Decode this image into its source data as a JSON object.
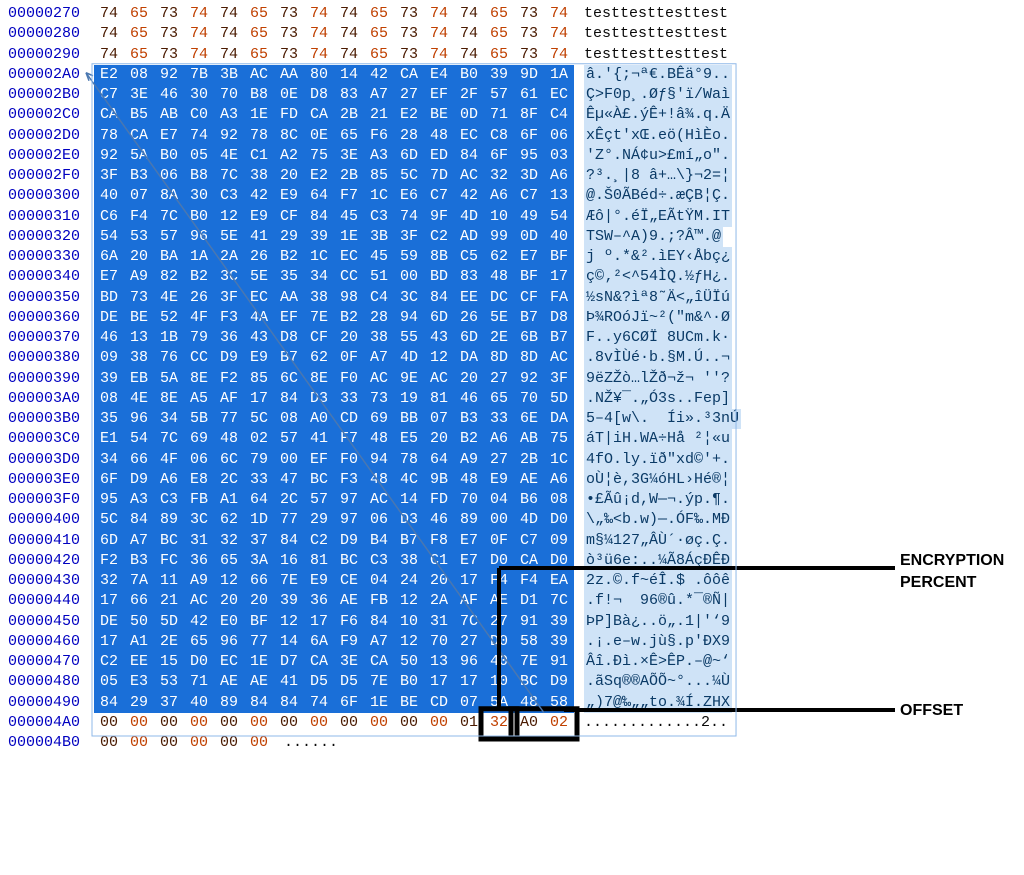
{
  "rows": [
    {
      "off": "00000270",
      "hex": "74 65 73 74 74 65 73 74 74 65 73 74 74 65 73 74",
      "asc": "testtesttesttest",
      "sel": false
    },
    {
      "off": "00000280",
      "hex": "74 65 73 74 74 65 73 74 74 65 73 74 74 65 73 74",
      "asc": "testtesttesttest",
      "sel": false
    },
    {
      "off": "00000290",
      "hex": "74 65 73 74 74 65 73 74 74 65 73 74 74 65 73 74",
      "asc": "testtesttesttest",
      "sel": false
    },
    {
      "off": "000002A0",
      "hex": "E2 08 92 7B 3B AC AA 80 14 42 CA E4 B0 39 9D 1A",
      "asc": "â.'{;¬ª€.BÊä°9..",
      "sel": true
    },
    {
      "off": "000002B0",
      "hex": "C7 3E 46 30 70 B8 0E D8 83 A7 27 EF 2F 57 61 EC",
      "asc": "Ç>F0p¸.Øƒ§'ï/Waì",
      "sel": true
    },
    {
      "off": "000002C0",
      "hex": "CA B5 AB C0 A3 1E FD CA 2B 21 E2 BE 0D 71 8F C4",
      "asc": "Êµ«À£.ýÊ+!â¾.q.Ä",
      "sel": true
    },
    {
      "off": "000002D0",
      "hex": "78 CA E7 74 92 78 8C 0E 65 F6 28 48 EC C8 6F 06",
      "asc": "xÊçt'xŒ.eö(HìÈo.",
      "sel": true
    },
    {
      "off": "000002E0",
      "hex": "92 5A B0 05 4E C1 A2 75 3E A3 6D ED 84 6F 95 03",
      "asc": "'Z°.NÁ¢u>£mí„o\".",
      "sel": true
    },
    {
      "off": "000002F0",
      "hex": "3F B3 06 B8 7C 38 20 E2 2B 85 5C 7D AC 32 3D A6",
      "asc": "?³.¸|8 â+…\\}¬2=¦",
      "sel": true
    },
    {
      "off": "00000300",
      "hex": "40 07 8A 30 C3 42 E9 64 F7 1C E6 C7 42 A6 C7 13",
      "asc": "@.Š0ÃBéd÷.æÇB¦Ç.",
      "sel": true
    },
    {
      "off": "00000310",
      "hex": "C6 F4 7C B0 12 E9 CF 84 45 C3 74 9F 4D 10 49 54",
      "asc": "Æô|°.éÏ„EÃtŸM.IT",
      "sel": true
    },
    {
      "off": "00000320",
      "hex": "54 53 57 96 5E 41 29 39 1E 3B 3F C2 AD 99 0D 40",
      "asc": "TSW–^A)9.;?Â­™.@",
      "sel": true
    },
    {
      "off": "00000330",
      "hex": "6A 20 BA 1A 2A 26 B2 1C EC 45 59 8B C5 62 E7 BF",
      "asc": "j º.*&².ìEY‹Åbç¿",
      "sel": true
    },
    {
      "off": "00000340",
      "hex": "E7 A9 82 B2 3C 5E 35 34 CC 51 00 BD 83 48 BF 17",
      "asc": "ç©‚²<^54ÌQ.½ƒH¿.",
      "sel": true
    },
    {
      "off": "00000350",
      "hex": "BD 73 4E 26 3F EC AA 38 98 C4 3C 84 EE DC CF FA",
      "asc": "½sN&?ìª8˜Ä<„îÜÏú",
      "sel": true
    },
    {
      "off": "00000360",
      "hex": "DE BE 52 4F F3 4A EF 7E B2 28 94 6D 26 5E B7 D8",
      "asc": "Þ¾ROóJï~²(\"m&^·Ø",
      "sel": true
    },
    {
      "off": "00000370",
      "hex": "46 13 1B 79 36 43 D8 CF 20 38 55 43 6D 2E 6B B7",
      "asc": "F..y6CØÏ 8UCm.k·",
      "sel": true
    },
    {
      "off": "00000380",
      "hex": "09 38 76 CC D9 E9 B7 62 0F A7 4D 12 DA 8D 8D AC",
      "asc": ".8vÌÙé·b.§M.Ú..¬",
      "sel": true
    },
    {
      "off": "00000390",
      "hex": "39 EB 5A 8E F2 85 6C 8E F0 AC 9E AC 20 27 92 3F",
      "asc": "9ëZŽò…lŽð¬ž¬ ''?",
      "sel": true
    },
    {
      "off": "000003A0",
      "hex": "08 4E 8E A5 AF 17 84 D3 33 73 19 81 46 65 70 5D",
      "asc": ".NŽ¥¯.„Ó3s..Fep]",
      "sel": true
    },
    {
      "off": "000003B0",
      "hex": "35 96 34 5B 77 5C 08 A0 CD 69 BB 07 B3 33 6E DA",
      "asc": "5–4[w\\.  Íi».³3nÚ",
      "sel": true
    },
    {
      "off": "000003C0",
      "hex": "E1 54 7C 69 48 02 57 41 F7 48 E5 20 B2 A6 AB 75",
      "asc": "áT|iH.WA÷Hå ²¦«u",
      "sel": true
    },
    {
      "off": "000003D0",
      "hex": "34 66 4F 06 6C 79 00 EF F0 94 78 64 A9 27 2B 1C",
      "asc": "4fO.ly.ïð\"xd©'+.",
      "sel": true
    },
    {
      "off": "000003E0",
      "hex": "6F D9 A6 E8 2C 33 47 BC F3 48 4C 9B 48 E9 AE A6",
      "asc": "oÙ¦è,3G¼óHL›Hé®¦",
      "sel": true
    },
    {
      "off": "000003F0",
      "hex": "95 A3 C3 FB A1 64 2C 57 97 AC 14 FD 70 04 B6 08",
      "asc": "•£Ãû¡d,W—¬.ýp.¶.",
      "sel": true
    },
    {
      "off": "00000400",
      "hex": "5C 84 89 3C 62 1D 77 29 97 06 D3 46 89 00 4D D0",
      "asc": "\\„‰<b.w)—.ÓF‰.MÐ",
      "sel": true
    },
    {
      "off": "00000410",
      "hex": "6D A7 BC 31 32 37 84 C2 D9 B4 B7 F8 E7 0F C7 09",
      "asc": "m§¼127„ÂÙ´·øç.Ç.",
      "sel": true
    },
    {
      "off": "00000420",
      "hex": "F2 B3 FC 36 65 3A 16 81 BC C3 38 C1 E7 D0 CA D0",
      "asc": "ò³ü6e:..¼Ã8ÁçÐÊÐ",
      "sel": true
    },
    {
      "off": "00000430",
      "hex": "32 7A 11 A9 12 66 7E E9 CE 04 24 20 17 F4 F4 EA",
      "asc": "2z.©.f~éÎ.$ .ôôê",
      "sel": true
    },
    {
      "off": "00000440",
      "hex": "17 66 21 AC 20 20 39 36 AE FB 12 2A AF AE D1 7C",
      "asc": ".f!¬  96®û.*¯®Ñ|",
      "sel": true
    },
    {
      "off": "00000450",
      "hex": "DE 50 5D 42 E0 BF 12 17 F6 84 10 31 7C 27 91 39",
      "asc": "ÞP]Bà¿..ö„.1|'‘9",
      "sel": true
    },
    {
      "off": "00000460",
      "hex": "17 A1 2E 65 96 77 14 6A F9 A7 12 70 27 D0 58 39",
      "asc": ".¡.e–w.jù§.p'ÐX9",
      "sel": true
    },
    {
      "off": "00000470",
      "hex": "C2 EE 15 D0 EC 1E D7 CA 3E CA 50 13 96 40 7E 91",
      "asc": "Âî.Ðì.×Ê>ÊP.–@~‘",
      "sel": true
    },
    {
      "off": "00000480",
      "hex": "05 E3 53 71 AE AE 41 D5 D5 7E B0 17 17 10 BC D9",
      "asc": ".ãSq®®AÕÕ~°...¼Ù",
      "sel": true
    },
    {
      "off": "00000490",
      "hex": "84 29 37 40 89 84 84 74 6F 1E BE CD 07 5A 48 58",
      "asc": "„)7@‰„„to.¾Í.ZHX",
      "sel": true
    },
    {
      "off": "000004A0",
      "hex": "00 00 00 00 00 00 00 00 00 00 00 00 01 32 A0 02",
      "asc": ".............2..",
      "sel": false
    },
    {
      "off": "000004B0",
      "hex": "00 00 00 00 00 00",
      "asc": "......",
      "sel": false
    }
  ],
  "annotations": {
    "encryption_percent": "ENCRYPTION\nPERCENT",
    "offset_label": "OFFSET"
  },
  "footer_boxes": {
    "percent_byte_index": 13,
    "offset_bytes_index": [
      14,
      15
    ]
  }
}
